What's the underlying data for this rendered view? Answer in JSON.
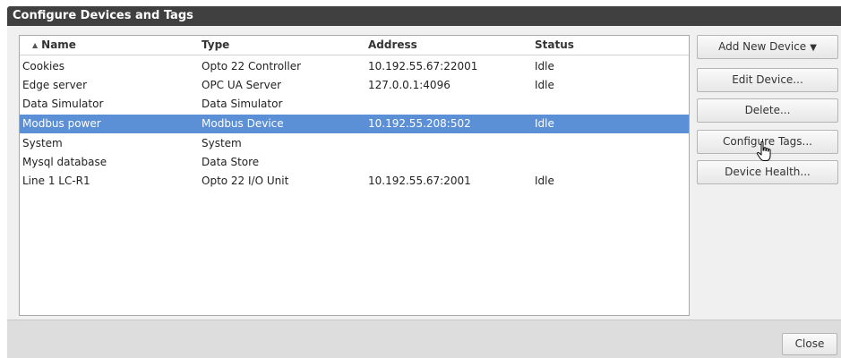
{
  "window": {
    "title": "Configure Devices and Tags"
  },
  "table": {
    "columns": [
      "Name",
      "Type",
      "Address",
      "Status"
    ],
    "rows": [
      {
        "name": "Cookies",
        "type": "Opto 22 Controller",
        "address": "10.192.55.67:22001",
        "status": "Idle",
        "selected": false
      },
      {
        "name": "Edge server",
        "type": "OPC UA Server",
        "address": "127.0.0.1:4096",
        "status": "Idle",
        "selected": false
      },
      {
        "name": "Data Simulator",
        "type": "Data Simulator",
        "address": "",
        "status": "",
        "selected": false
      },
      {
        "name": "Modbus power",
        "type": "Modbus Device",
        "address": "10.192.55.208:502",
        "status": "Idle",
        "selected": true
      },
      {
        "name": "System",
        "type": "System",
        "address": "",
        "status": "",
        "selected": false
      },
      {
        "name": "Mysql database",
        "type": "Data Store",
        "address": "",
        "status": "",
        "selected": false
      },
      {
        "name": "Line 1 LC-R1",
        "type": "Opto 22 I/O Unit",
        "address": "10.192.55.67:2001",
        "status": "Idle",
        "selected": false
      }
    ],
    "sort_icon": "sort-ascending-icon"
  },
  "buttons": {
    "add_new": "Add New Device",
    "edit": "Edit Device...",
    "delete": "Delete...",
    "configure_tags": "Configure Tags...",
    "device_health": "Device Health...",
    "close": "Close"
  },
  "colors": {
    "title_bg": "#404040",
    "selection": "#5b8fd6",
    "panel_bg": "#f0f0f0",
    "footer_bg": "#dddddd"
  }
}
